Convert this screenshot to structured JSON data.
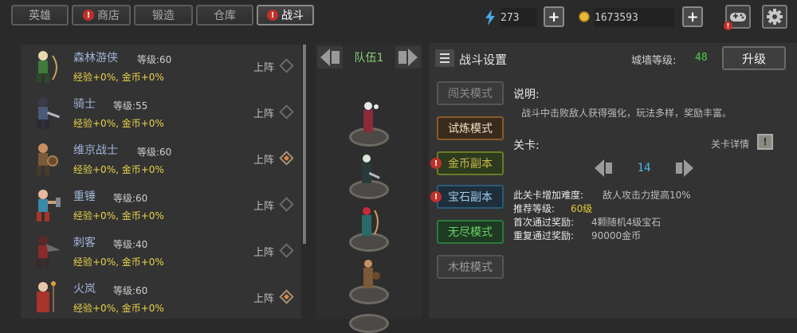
{
  "tabs": [
    {
      "label": "英雄",
      "alert": false,
      "active": false
    },
    {
      "label": "商店",
      "alert": true,
      "active": false
    },
    {
      "label": "锻造",
      "alert": false,
      "active": false
    },
    {
      "label": "仓库",
      "alert": false,
      "active": false
    },
    {
      "label": "战斗",
      "alert": true,
      "active": true
    }
  ],
  "resources": {
    "energy": {
      "icon": "lightning-icon",
      "value": "273"
    },
    "gold": {
      "icon": "gold-coin-icon",
      "value": "1673593"
    }
  },
  "heroes": [
    {
      "name": "森林游侠",
      "level": "等级:60",
      "bonus": "经验+0%, 金币+0%",
      "deploy": "上阵",
      "checked": false,
      "sprite": "ranger-sprite-icon",
      "color": "#3f7a3a"
    },
    {
      "name": "骑士",
      "level": "等级:55",
      "bonus": "经验+0%, 金币+0%",
      "deploy": "上阵",
      "checked": false,
      "sprite": "knight-sprite-icon",
      "color": "#4a5a78"
    },
    {
      "name": "维京战士",
      "level": "等级:60",
      "bonus": "经验+0%, 金币+0%",
      "deploy": "上阵",
      "checked": true,
      "sprite": "viking-sprite-icon",
      "color": "#7a5a3a"
    },
    {
      "name": "重锤",
      "level": "等级:60",
      "bonus": "经验+0%, 金币+0%",
      "deploy": "上阵",
      "checked": false,
      "sprite": "hammer-sprite-icon",
      "color": "#3a8aa8"
    },
    {
      "name": "刺客",
      "level": "等级:40",
      "bonus": "经验+0%, 金币+0%",
      "deploy": "上阵",
      "checked": false,
      "sprite": "assassin-sprite-icon",
      "color": "#8a2a2a"
    },
    {
      "name": "火岚",
      "level": "等级:60",
      "bonus": "经验+0%, 金币+0%",
      "deploy": "上阵",
      "checked": true,
      "sprite": "mage-sprite-icon",
      "color": "#a8342a"
    }
  ],
  "team": {
    "label": "队伍1"
  },
  "battle": {
    "title": "战斗设置",
    "wall_label": "城墙等级:",
    "wall_level": "48",
    "upgrade_label": "升级",
    "modes": [
      {
        "label": "闯关模式",
        "alert": false,
        "color": "#8a8a8a",
        "bg": "#3a3a3a",
        "border": "#555"
      },
      {
        "label": "试炼模式",
        "alert": false,
        "color": "#f0e0c0",
        "bg": "#3a2a1e",
        "border": "#8a5a2a"
      },
      {
        "label": "金币副本",
        "alert": true,
        "color": "#c8b84a",
        "bg": "#2e3a1e",
        "border": "#6a7a2a"
      },
      {
        "label": "宝石副本",
        "alert": true,
        "color": "#a0c8e8",
        "bg": "#1e2e3a",
        "border": "#2a5a7a"
      },
      {
        "label": "无尽模式",
        "alert": false,
        "color": "#6ad06a",
        "bg": "#1e3a22",
        "border": "#2a7a3a"
      },
      {
        "label": "木桩模式",
        "alert": false,
        "color": "#9a9a9a",
        "bg": "#3a3a3a",
        "border": "#555"
      }
    ],
    "desc_label": "说明:",
    "desc_text": "战斗中击败敌人获得强化，玩法多样，奖励丰富。",
    "stage_label": "关卡:",
    "stage_detail_label": "关卡详情",
    "stage_value": "14",
    "difficulty_label": "此关卡增加难度:",
    "difficulty_value": "敌人攻击力提高10%",
    "rec_level_label": "推荐等级:",
    "rec_level_value": "60级",
    "first_reward_label": "首次通过奖励:",
    "first_reward_value": "4颗随机4级宝石",
    "repeat_reward_label": "重复通过奖励:",
    "repeat_reward_value": "90000金币"
  }
}
